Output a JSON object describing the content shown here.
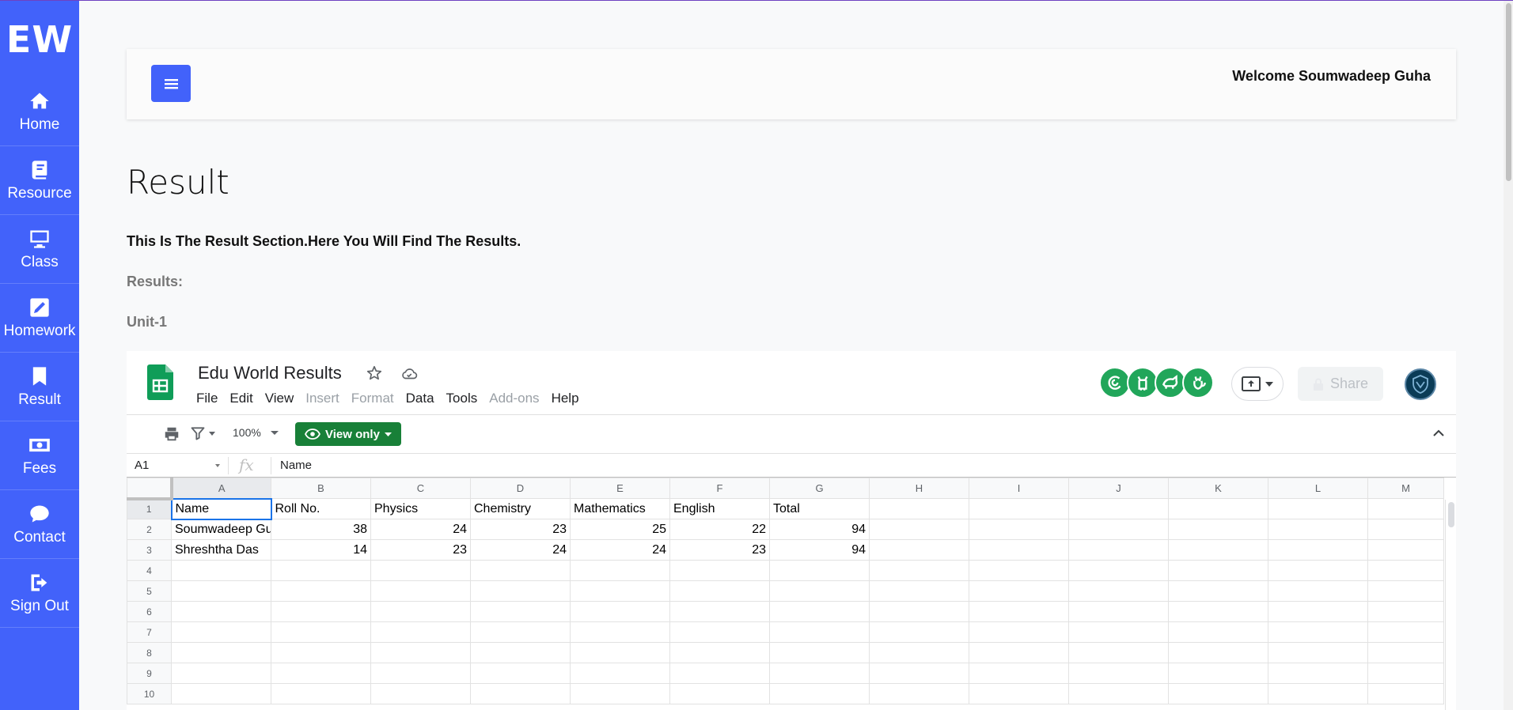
{
  "sidebar": {
    "logo": "EW",
    "items": [
      {
        "label": "Home",
        "icon": "home-icon"
      },
      {
        "label": "Resource",
        "icon": "book-icon"
      },
      {
        "label": "Class",
        "icon": "monitor-icon"
      },
      {
        "label": "Homework",
        "icon": "edit-icon"
      },
      {
        "label": "Result",
        "icon": "bookmark-icon"
      },
      {
        "label": "Fees",
        "icon": "money-icon"
      },
      {
        "label": "Contact",
        "icon": "chat-icon"
      },
      {
        "label": "Sign Out",
        "icon": "sign-out-icon"
      }
    ]
  },
  "header": {
    "welcome": "Welcome Soumwadeep Guha"
  },
  "main": {
    "title": "Result",
    "description": "This Is The Result Section.Here You Will Find The Results.",
    "results_label": "Results:",
    "unit_label": "Unit-1"
  },
  "sheet": {
    "doc_title": "Edu World Results",
    "menus": [
      {
        "label": "File",
        "enabled": true
      },
      {
        "label": "Edit",
        "enabled": true
      },
      {
        "label": "View",
        "enabled": true
      },
      {
        "label": "Insert",
        "enabled": false
      },
      {
        "label": "Format",
        "enabled": false
      },
      {
        "label": "Data",
        "enabled": true
      },
      {
        "label": "Tools",
        "enabled": true
      },
      {
        "label": "Add-ons",
        "enabled": false
      },
      {
        "label": "Help",
        "enabled": true
      }
    ],
    "share_label": "Share",
    "zoom": "100%",
    "view_only_label": "View only",
    "name_box": "A1",
    "formula_value": "Name",
    "columns": [
      "A",
      "B",
      "C",
      "D",
      "E",
      "F",
      "G",
      "H",
      "I",
      "J",
      "K",
      "L",
      "M"
    ],
    "row_numbers": [
      "1",
      "2",
      "3",
      "4",
      "5",
      "6",
      "7",
      "8",
      "9",
      "10"
    ],
    "rows": [
      [
        "Name",
        "Roll No.",
        "Physics",
        "Chemistry",
        "Mathematics",
        "English",
        "Total"
      ],
      [
        "Soumwadeep Guha",
        "38",
        "24",
        "23",
        "25",
        "22",
        "94"
      ],
      [
        "Shreshtha Das",
        "14",
        "23",
        "24",
        "24",
        "23",
        "94"
      ]
    ],
    "colors": {
      "sheets_green": "#188038",
      "accent": "#4262fa"
    }
  }
}
